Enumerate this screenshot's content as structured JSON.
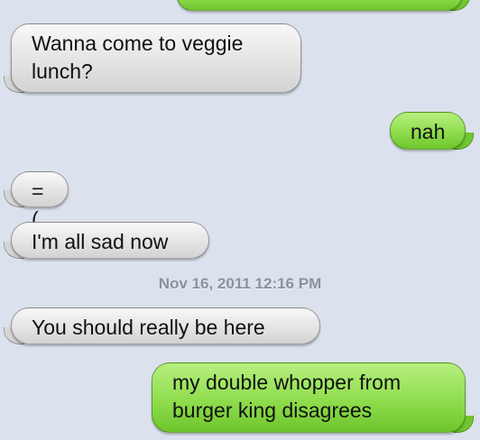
{
  "thread": {
    "messages": [
      {
        "id": "m0",
        "direction": "outgoing",
        "text": ""
      },
      {
        "id": "m1",
        "direction": "incoming",
        "text": "Wanna come to veggie lunch?"
      },
      {
        "id": "m2",
        "direction": "outgoing",
        "text": "nah"
      },
      {
        "id": "m3",
        "direction": "incoming",
        "text": "=("
      },
      {
        "id": "m4",
        "direction": "incoming",
        "text": "I'm all sad now"
      },
      {
        "id": "m5",
        "direction": "incoming",
        "text": "You should really be here"
      },
      {
        "id": "m6",
        "direction": "outgoing",
        "text": "my double whopper from burger king disagrees"
      }
    ],
    "timestamp": "Nov 16, 2011 12:16 PM"
  },
  "colors": {
    "background": "#dbe2ed",
    "incoming_bubble": "#e4e4e4",
    "outgoing_bubble": "#8fdd4d",
    "timestamp_text": "#8b919c"
  }
}
